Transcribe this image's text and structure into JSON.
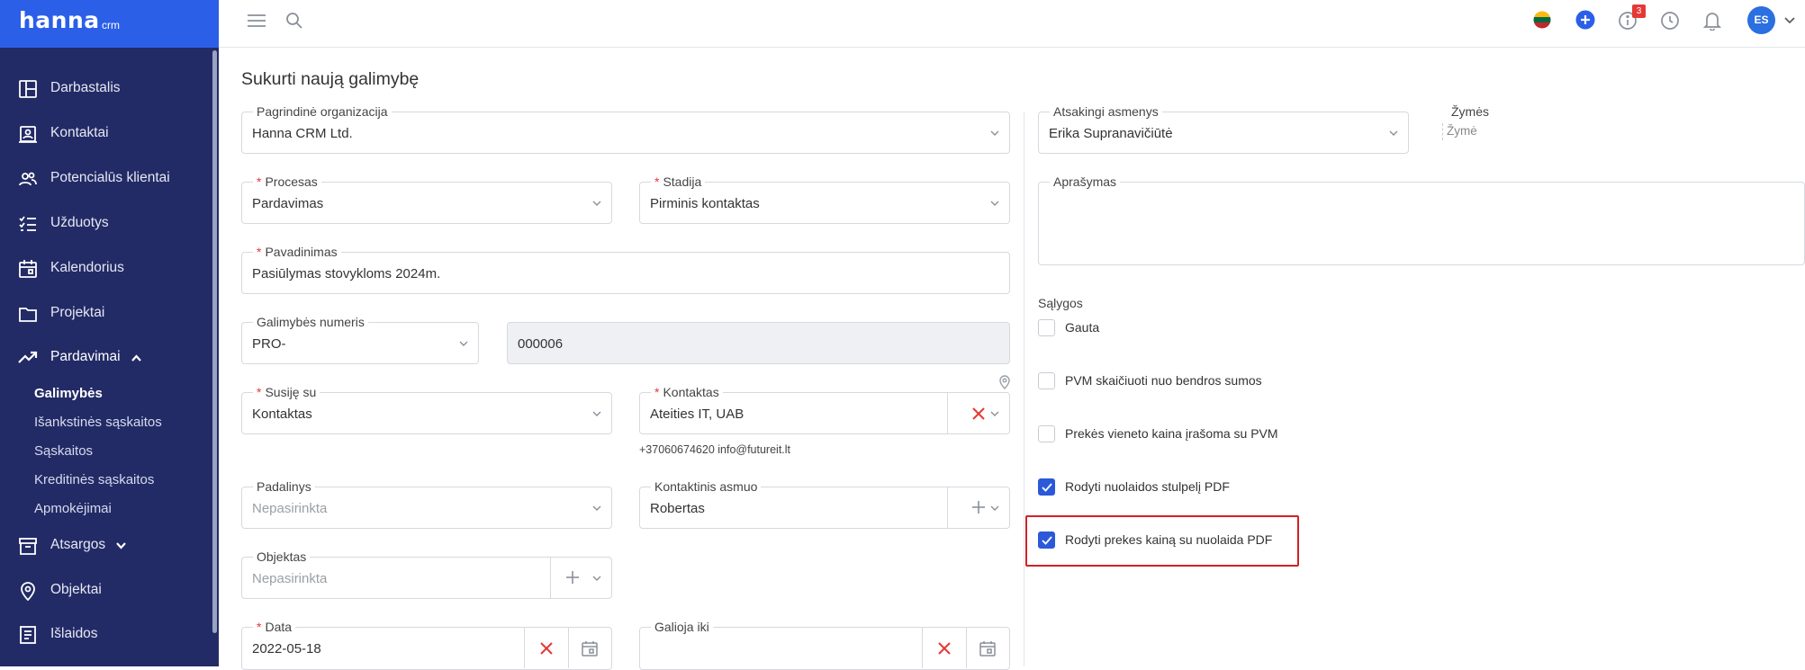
{
  "app": {
    "brand": "hanna",
    "brand_suffix": "crm"
  },
  "sidebar": {
    "items": [
      {
        "label": "Darbastalis",
        "icon": "dashboard-icon"
      },
      {
        "label": "Kontaktai",
        "icon": "contacts-icon"
      },
      {
        "label": "Potencialūs klientai",
        "icon": "leads-icon"
      },
      {
        "label": "Užduotys",
        "icon": "tasks-icon"
      },
      {
        "label": "Kalendorius",
        "icon": "calendar-icon"
      },
      {
        "label": "Projektai",
        "icon": "folder-icon"
      },
      {
        "label": "Pardavimai",
        "icon": "trending-up-icon"
      },
      {
        "label": "Atsargos",
        "icon": "archive-icon"
      },
      {
        "label": "Objektai",
        "icon": "location-pin-icon"
      },
      {
        "label": "Išlaidos",
        "icon": "receipt-icon"
      }
    ],
    "sales_sub": [
      "Galimybės",
      "Išankstinės sąskaitos",
      "Sąskaitos",
      "Kreditinės sąskaitos",
      "Apmokėjimai"
    ]
  },
  "topbar": {
    "notification_count": "3",
    "avatar_initials": "ES",
    "colors": {
      "accent": "#2b5fe8",
      "sidebar": "#232b66",
      "badge": "#e53935"
    }
  },
  "page": {
    "title": "Sukurti naują galimybę"
  },
  "form": {
    "org": {
      "label": "Pagrindinė organizacija",
      "value": "Hanna CRM Ltd."
    },
    "process": {
      "label": "Procesas",
      "value": "Pardavimas"
    },
    "stage": {
      "label": "Stadija",
      "value": "Pirminis kontaktas"
    },
    "name": {
      "label": "Pavadinimas",
      "value": "Pasiūlymas stovykloms 2024m."
    },
    "number": {
      "label": "Galimybės numeris",
      "prefix": "PRO-",
      "value": "000006"
    },
    "related": {
      "label": "Susiję su",
      "value": "Kontaktas"
    },
    "contact": {
      "label": "Kontaktas",
      "value": "Ateities IT, UAB",
      "details": "+37060674620 info@futureit.lt"
    },
    "unit": {
      "label": "Padalinys",
      "placeholder": "Nepasirinkta"
    },
    "contact_person": {
      "label": "Kontaktinis asmuo",
      "value": "Robertas"
    },
    "object": {
      "label": "Objektas",
      "placeholder": "Nepasirinkta"
    },
    "date": {
      "label": "Data",
      "value": "2022-05-18"
    },
    "valid_until": {
      "label": "Galioja iki",
      "value": ""
    },
    "responsible": {
      "label": "Atsakingi asmenys",
      "value": "Erika Supranavičiūtė"
    },
    "tags": {
      "label": "Žymės",
      "placeholder": "Žymė"
    },
    "description": {
      "label": "Aprašymas",
      "value": ""
    },
    "conditions": {
      "title": "Sąlygos",
      "items": [
        {
          "label": "Gauta",
          "checked": false
        },
        {
          "label": "PVM skaičiuoti nuo bendros sumos",
          "checked": false
        },
        {
          "label": "Prekės vieneto kaina įrašoma su PVM",
          "checked": false
        },
        {
          "label": "Rodyti nuolaidos stulpelį PDF",
          "checked": true
        },
        {
          "label": "Rodyti prekes kainą su nuolaida PDF",
          "checked": true
        }
      ]
    }
  }
}
